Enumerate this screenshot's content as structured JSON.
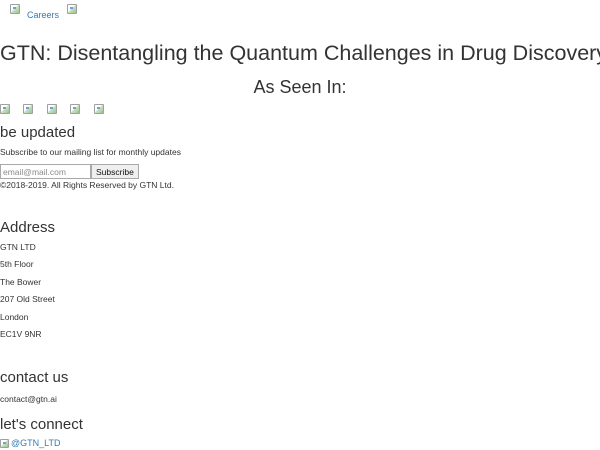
{
  "nav": {
    "careers_label": "Careers"
  },
  "hero": {
    "title": "GTN: Disentangling the Quantum Challenges in Drug Discovery",
    "seen_in_heading": "As Seen In:",
    "press_logo_count": 5
  },
  "newsletter": {
    "heading": "be updated",
    "description": "Subscribe to our mailing list for monthly updates",
    "email_placeholder": "email@mail.com",
    "email_value": "",
    "subscribe_label": "Subscribe"
  },
  "copyright": "©2018-2019. All Rights Reserved by GTN Ltd.",
  "address": {
    "heading": "Address",
    "lines": [
      "GTN LTD",
      "5th Floor",
      "The Bower",
      "207 Old Street",
      "London",
      "EC1V 9NR"
    ]
  },
  "contact": {
    "heading": "contact us",
    "email": "contact@gtn.ai"
  },
  "connect": {
    "heading": "let's connect",
    "twitter_handle": "@GTN_LTD",
    "twitter_icon": "twitter-icon"
  },
  "colors": {
    "link": "#337ab7",
    "text": "#333333"
  }
}
